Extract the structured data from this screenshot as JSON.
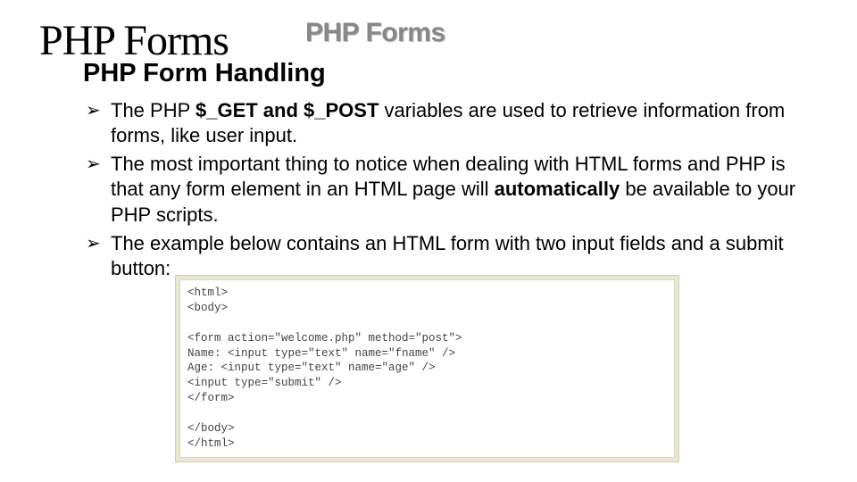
{
  "header": {
    "bg_title": "PHP Forms",
    "subtitle": "PHP Form Handling",
    "graphic_title": "PHP Forms"
  },
  "bullets": [
    {
      "marker": "➢",
      "segments": [
        {
          "t": "The PHP ",
          "b": false
        },
        {
          "t": "$_GET and $_POST",
          "b": true
        },
        {
          "t": " variables are used to retrieve information from forms, like user input.",
          "b": false
        }
      ]
    },
    {
      "marker": "➢",
      "segments": [
        {
          "t": "The most important thing to notice when dealing with HTML forms and PHP is that any form element in an HTML page will ",
          "b": false
        },
        {
          "t": "automatically",
          "b": true
        },
        {
          "t": " be available to your PHP scripts.",
          "b": false
        }
      ]
    },
    {
      "marker": "➢",
      "segments": [
        {
          "t": "The example below contains an HTML form with two input fields and a submit button:",
          "b": false
        }
      ]
    }
  ],
  "code": "<html>\n<body>\n\n<form action=\"welcome.php\" method=\"post\">\nName: <input type=\"text\" name=\"fname\" />\nAge: <input type=\"text\" name=\"age\" />\n<input type=\"submit\" />\n</form>\n\n</body>\n</html>"
}
